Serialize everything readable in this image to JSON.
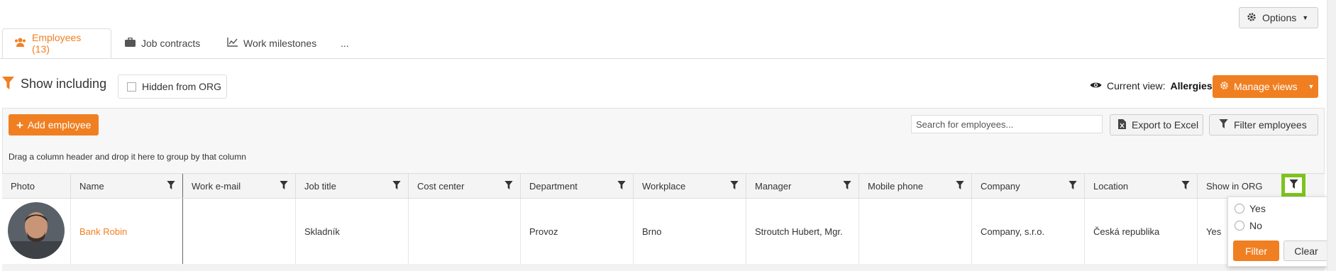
{
  "options": {
    "label": "Options"
  },
  "tabs": [
    {
      "label": "Employees (13)",
      "icon": "users-icon"
    },
    {
      "label": "Job contracts",
      "icon": "briefcase-icon"
    },
    {
      "label": "Work milestones",
      "icon": "chart-line-icon"
    },
    {
      "label": "..."
    }
  ],
  "filter_bar": {
    "title": "Show including",
    "checkbox_label": "Hidden from ORG"
  },
  "view": {
    "prefix": "Current view:",
    "name": "Allergies",
    "manage_label": "Manage views"
  },
  "toolbar": {
    "add_label": "Add employee",
    "search_placeholder": "Search for employees...",
    "export_label": "Export to Excel",
    "filter_label": "Filter employees"
  },
  "group_hint": "Drag a column header and drop it here to group by that column",
  "columns": [
    "Photo",
    "Name",
    "Work e-mail",
    "Job title",
    "Cost center",
    "Department",
    "Workplace",
    "Manager",
    "Mobile phone",
    "Company",
    "Location",
    "Show in ORG"
  ],
  "row": {
    "name": "Bank Robin",
    "work_email": "",
    "job_title": "Skladník",
    "cost_center": "",
    "department": "Provoz",
    "workplace": "Brno",
    "manager": "Stroutch Hubert, Mgr.",
    "mobile": "",
    "company": "Company, s.r.o.",
    "location": "Česká republika",
    "show_in_org": "Yes"
  },
  "popup": {
    "yes": "Yes",
    "no": "No",
    "filter": "Filter",
    "clear": "Clear"
  },
  "colors": {
    "accent": "#f07f22",
    "highlight": "#7cc41d"
  }
}
